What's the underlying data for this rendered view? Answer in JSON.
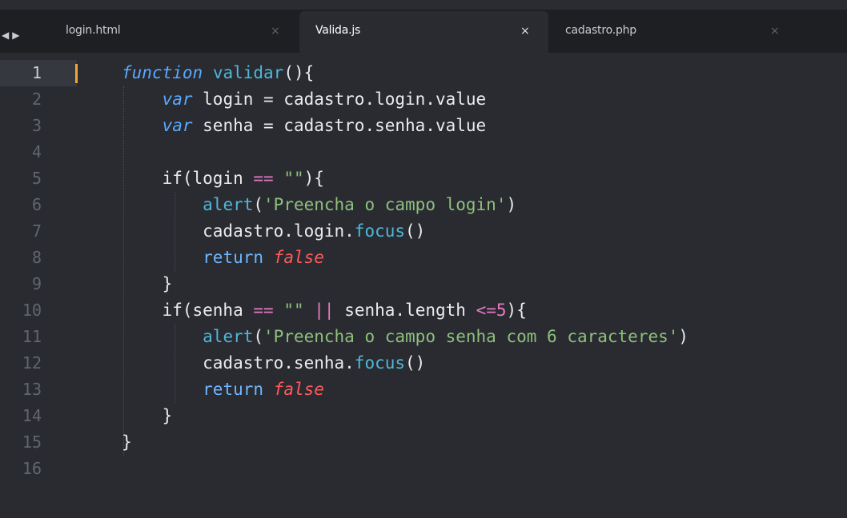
{
  "tabs": [
    {
      "label": "login.html",
      "close": "×",
      "active": false
    },
    {
      "label": "Valida.js",
      "close": "×",
      "active": true
    },
    {
      "label": "cadastro.php",
      "close": "×",
      "active": false
    }
  ],
  "nav": {
    "back": "◀",
    "forward": "▶"
  },
  "editor": {
    "line_numbers": [
      "1",
      "2",
      "3",
      "4",
      "5",
      "6",
      "7",
      "8",
      "9",
      "10",
      "11",
      "12",
      "13",
      "14",
      "15",
      "16"
    ],
    "current_line": "1",
    "lines": [
      [
        {
          "t": "function",
          "c": "kw-fn"
        },
        {
          "t": " ",
          "c": "plain"
        },
        {
          "t": "validar",
          "c": "fn-name"
        },
        {
          "t": "(){",
          "c": "plain"
        }
      ],
      [
        {
          "t": "    ",
          "c": "plain"
        },
        {
          "t": "var",
          "c": "kw-var"
        },
        {
          "t": " login = cadastro.login.value",
          "c": "plain"
        }
      ],
      [
        {
          "t": "    ",
          "c": "plain"
        },
        {
          "t": "var",
          "c": "kw-var"
        },
        {
          "t": " senha = cadastro.senha.value",
          "c": "plain"
        }
      ],
      [],
      [
        {
          "t": "    if(login ",
          "c": "plain"
        },
        {
          "t": "==",
          "c": "op"
        },
        {
          "t": " ",
          "c": "plain"
        },
        {
          "t": "\"\"",
          "c": "str"
        },
        {
          "t": "){",
          "c": "plain"
        }
      ],
      [
        {
          "t": "        ",
          "c": "plain"
        },
        {
          "t": "alert",
          "c": "method"
        },
        {
          "t": "(",
          "c": "plain"
        },
        {
          "t": "'Preencha o campo login'",
          "c": "str"
        },
        {
          "t": ")",
          "c": "plain"
        }
      ],
      [
        {
          "t": "        cadastro.login.",
          "c": "plain"
        },
        {
          "t": "focus",
          "c": "method"
        },
        {
          "t": "()",
          "c": "plain"
        }
      ],
      [
        {
          "t": "        ",
          "c": "plain"
        },
        {
          "t": "return",
          "c": "ret"
        },
        {
          "t": " ",
          "c": "plain"
        },
        {
          "t": "false",
          "c": "bool"
        }
      ],
      [
        {
          "t": "    }",
          "c": "plain"
        }
      ],
      [
        {
          "t": "    if(senha ",
          "c": "plain"
        },
        {
          "t": "==",
          "c": "op"
        },
        {
          "t": " ",
          "c": "plain"
        },
        {
          "t": "\"\"",
          "c": "str"
        },
        {
          "t": " ",
          "c": "plain"
        },
        {
          "t": "||",
          "c": "op"
        },
        {
          "t": " senha.length ",
          "c": "plain"
        },
        {
          "t": "<=",
          "c": "op"
        },
        {
          "t": "5",
          "c": "num"
        },
        {
          "t": "){",
          "c": "plain"
        }
      ],
      [
        {
          "t": "        ",
          "c": "plain"
        },
        {
          "t": "alert",
          "c": "method"
        },
        {
          "t": "(",
          "c": "plain"
        },
        {
          "t": "'Preencha o campo senha com 6 caracteres'",
          "c": "str"
        },
        {
          "t": ")",
          "c": "plain"
        }
      ],
      [
        {
          "t": "        cadastro.senha.",
          "c": "plain"
        },
        {
          "t": "focus",
          "c": "method"
        },
        {
          "t": "()",
          "c": "plain"
        }
      ],
      [
        {
          "t": "        ",
          "c": "plain"
        },
        {
          "t": "return",
          "c": "ret"
        },
        {
          "t": " ",
          "c": "plain"
        },
        {
          "t": "false",
          "c": "bool"
        }
      ],
      [
        {
          "t": "    }",
          "c": "plain"
        }
      ],
      [
        {
          "t": "}",
          "c": "plain"
        }
      ],
      []
    ]
  }
}
